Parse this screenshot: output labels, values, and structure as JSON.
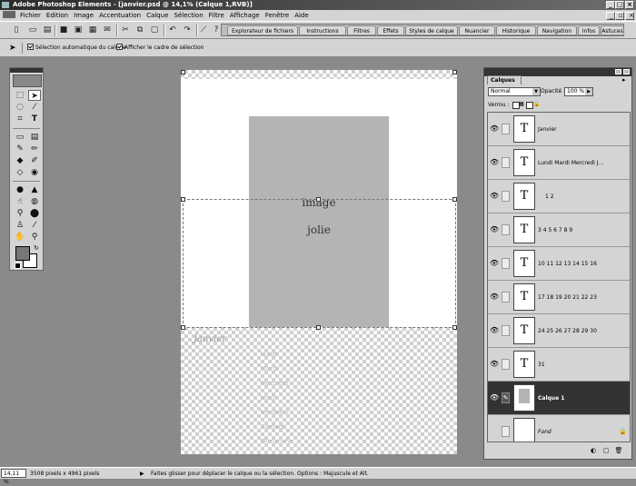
{
  "window": {
    "title": "Adobe Photoshop Elements - [janvier.psd @ 14,1% (Calque  1,RVB)]"
  },
  "menu": [
    "Fichier",
    "Edition",
    "Image",
    "Accentuation",
    "Calque",
    "Sélection",
    "Filtre",
    "Affichage",
    "Fenêtre",
    "Aide"
  ],
  "palette_well": [
    "Explorateur de fichiers",
    "Instructions",
    "Filtres",
    "Effets",
    "Styles de calque",
    "Nuancier",
    "Historique",
    "Navigation",
    "Infos",
    "Astuces"
  ],
  "options": {
    "auto_select_label": "Sélection automatique du calque",
    "bounding_box_label": "Afficher le cadre de sélection"
  },
  "document": {
    "text_line1": "image",
    "text_line2": "jolie",
    "month": "Janvier",
    "days": [
      "Lundi",
      "Mardi",
      "Mercredi",
      "Jeudi",
      "Vendredi",
      "Samedi",
      "Dimanche"
    ]
  },
  "layers_palette": {
    "tab": "Calques",
    "blend_mode": "Normal",
    "opacity_label": "Opacité :",
    "opacity_value": "100 %",
    "lock_label": "Verrou :",
    "layers": [
      {
        "name": "Janvier",
        "type": "text",
        "visible": true,
        "selected": false
      },
      {
        "name": "Lundi Mardi Mercredi J...",
        "type": "text",
        "visible": true,
        "selected": false
      },
      {
        "name": "1 2",
        "type": "text",
        "visible": true,
        "selected": false
      },
      {
        "name": "3 4 5 6 7 8 9",
        "type": "text",
        "visible": true,
        "selected": false
      },
      {
        "name": "10 11 12 13 14 15 16",
        "type": "text",
        "visible": true,
        "selected": false
      },
      {
        "name": "17 18 19 20 21 22 23",
        "type": "text",
        "visible": true,
        "selected": false
      },
      {
        "name": "24 25 26 27 28 29 30",
        "type": "text",
        "visible": true,
        "selected": false
      },
      {
        "name": "31",
        "type": "text",
        "visible": true,
        "selected": false
      },
      {
        "name": "Calque  1",
        "type": "image",
        "visible": true,
        "selected": true
      },
      {
        "name": "Fond",
        "type": "background",
        "visible": false,
        "selected": false
      }
    ],
    "text_thumb_glyph": "T"
  },
  "status": {
    "zoom": "14,11 %",
    "doc_size": "3508 pixels x 4961 pixels",
    "hint": "Faites glisser pour déplacer le calque ou la sélection. Options : Majuscule et Alt."
  },
  "colors": {
    "selected_layer": "#333333",
    "chrome": "#d4d4d4"
  }
}
